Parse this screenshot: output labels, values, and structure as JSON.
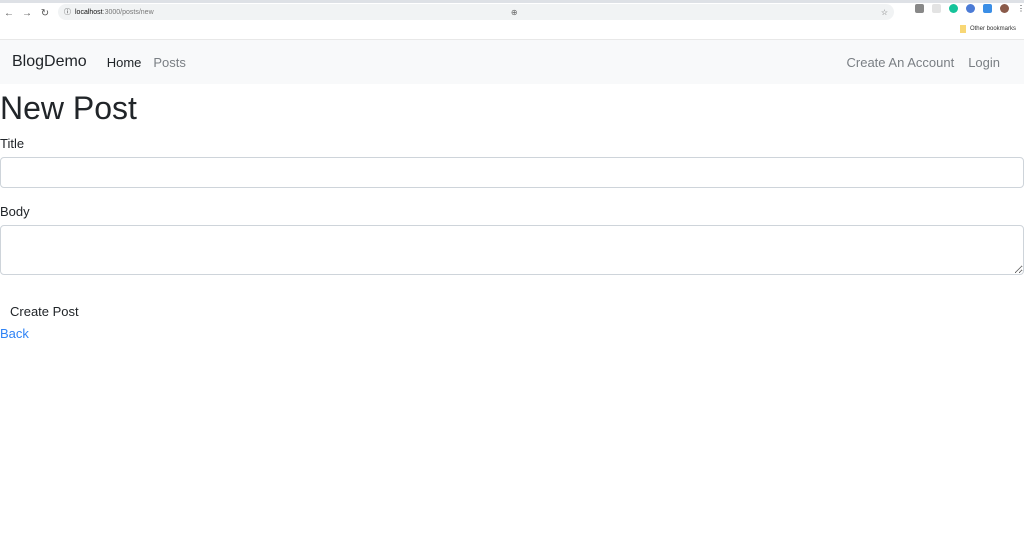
{
  "browser": {
    "url_host": "localhost",
    "url_path": ":3000/posts/new",
    "bookmarks_label": "Other bookmarks"
  },
  "navbar": {
    "brand": "BlogDemo",
    "links": [
      "Home",
      "Posts"
    ],
    "right_links": [
      "Create An Account",
      "Login"
    ]
  },
  "page": {
    "title": "New Post",
    "title_label": "Title",
    "title_value": "",
    "body_label": "Body",
    "body_value": "",
    "submit": "Create Post",
    "back": "Back"
  },
  "colors": {
    "link": "#2f83f5",
    "navbar_bg": "#f8f9fa"
  }
}
